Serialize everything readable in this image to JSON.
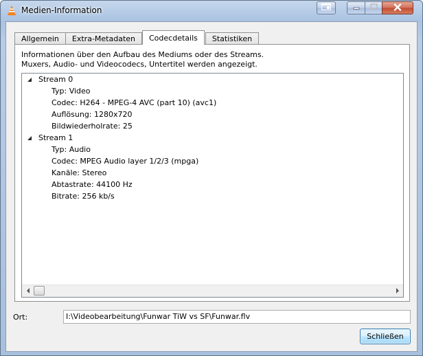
{
  "window": {
    "title": "Medien-Information"
  },
  "tabs": [
    {
      "label": "Allgemein",
      "active": false
    },
    {
      "label": "Extra-Metadaten",
      "active": false
    },
    {
      "label": "Codecdetails",
      "active": true
    },
    {
      "label": "Statistiken",
      "active": false
    }
  ],
  "panel": {
    "description_line1": "Informationen über den Aufbau des Mediums oder des Streams.",
    "description_line2": "Muxers, Audio- und Videocodecs, Untertitel werden angezeigt."
  },
  "streams": [
    {
      "name": "Stream 0",
      "properties": [
        "Typ: Video",
        "Codec: H264 - MPEG-4 AVC (part 10) (avc1)",
        "Auflösung: 1280x720",
        "Bildwiederholrate: 25"
      ]
    },
    {
      "name": "Stream 1",
      "properties": [
        "Typ: Audio",
        "Codec: MPEG Audio layer 1/2/3 (mpga)",
        "Kanäle: Stereo",
        "Abtastrate: 44100 Hz",
        "Bitrate: 256 kb/s"
      ]
    }
  ],
  "location": {
    "label": "Ort:",
    "value": "I:\\Videobearbeitung\\Funwar TiW vs SF\\Funwar.flv"
  },
  "buttons": {
    "close_label": "Schließen"
  },
  "icons": {
    "app": "vlc-cone-icon",
    "extra": "window-extra-icon",
    "minimize": "minimize-icon",
    "maximize": "maximize-icon",
    "close": "close-icon",
    "expander": "tree-expanded-triangle-icon"
  },
  "colors": {
    "title_bar": "#b7cce6",
    "close_button": "#c24a30",
    "default_button": "#a7d9f5"
  }
}
